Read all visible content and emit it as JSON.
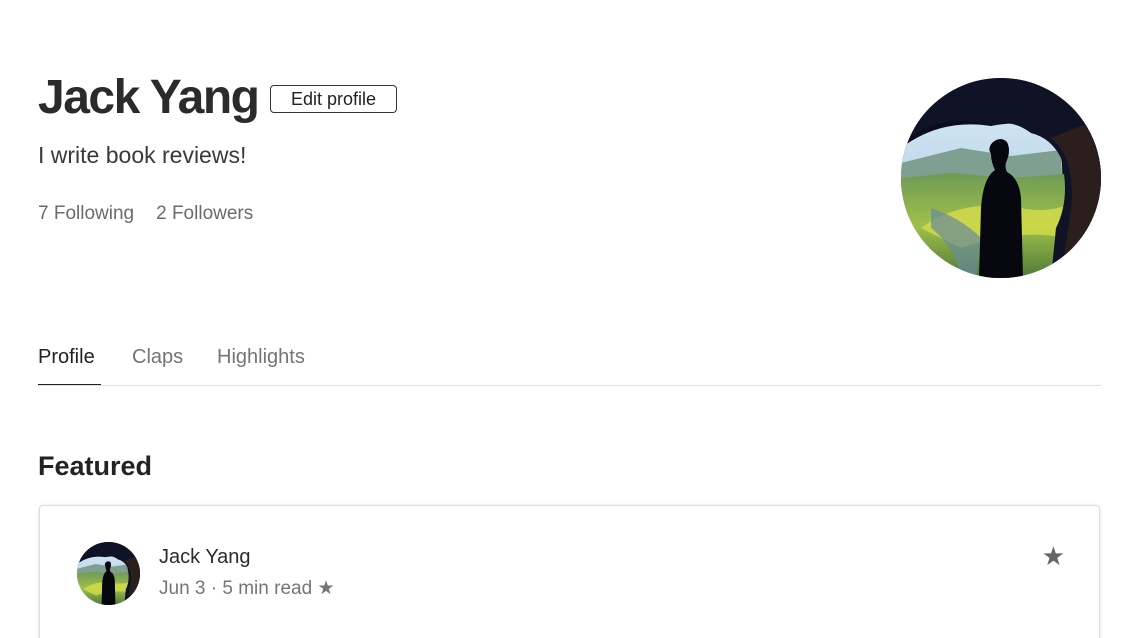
{
  "profile": {
    "name": "Jack Yang",
    "edit_label": "Edit profile",
    "bio": "I write book reviews!",
    "following": "7 Following",
    "followers": "2 Followers"
  },
  "tabs": [
    {
      "label": "Profile",
      "active": true
    },
    {
      "label": "Claps",
      "active": false
    },
    {
      "label": "Highlights",
      "active": false
    }
  ],
  "featured": {
    "heading": "Featured",
    "card": {
      "author": "Jack Yang",
      "date": "Jun 3",
      "separator": "·",
      "read_time": "5 min read",
      "meta_star": "★",
      "bookmark_star": "★"
    }
  },
  "colors": {
    "text_primary": "#222222",
    "text_secondary": "#757575",
    "divider": "#e0e0e0"
  }
}
